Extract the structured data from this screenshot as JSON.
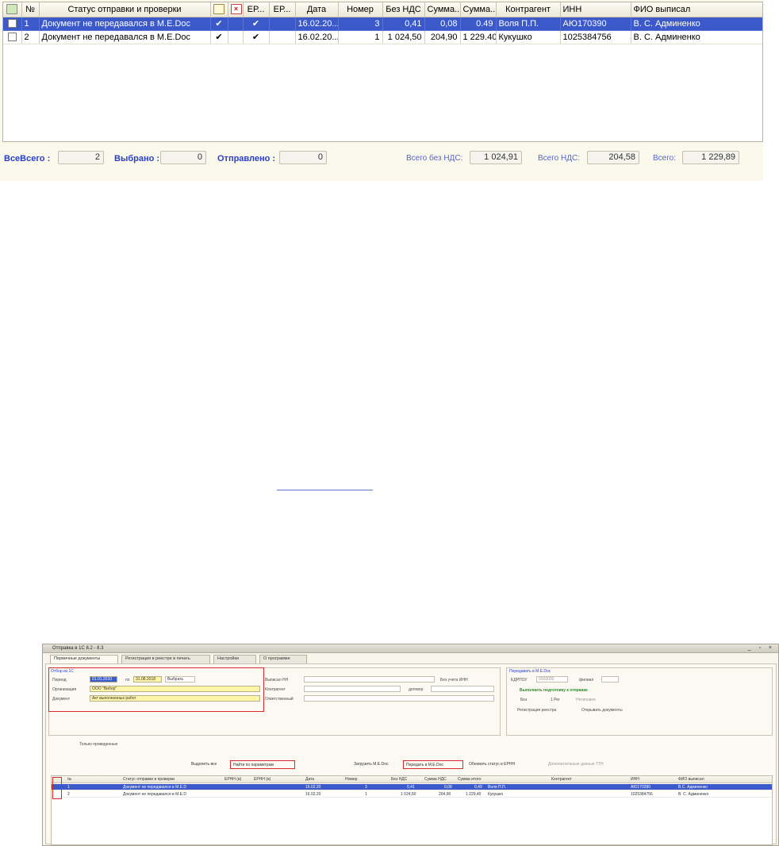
{
  "grid": {
    "columns": [
      "",
      "№",
      "Статус отправки и проверки",
      "",
      "",
      "ЕР...",
      "ЕР...",
      "Дата",
      "Номер",
      "Без НДС",
      "Сумма...",
      "Сумма...",
      "Контрагент",
      "ИНН",
      "ФИО выписал"
    ],
    "header_icons": [
      "select-all-icon",
      "document-icon",
      "delete-icon"
    ],
    "rows": [
      {
        "num": "1",
        "status": "Документ не передавался в M.E.Doc",
        "c1": "✔",
        "c2": "",
        "er1": "✔",
        "er2": "",
        "date": "16.02.20...",
        "number": "3",
        "no_vat": "0,41",
        "vat": "0,08",
        "total": "0.49",
        "counterparty": "Воля П.П.",
        "inn": "АЮ170390",
        "issued_by": "В. С. Админенко",
        "selected": true
      },
      {
        "num": "2",
        "status": "Документ не передавался в M.E.Doc",
        "c1": "✔",
        "c2": "",
        "er1": "✔",
        "er2": "",
        "date": "16.02.20...",
        "number": "1",
        "no_vat": "1 024,50",
        "vat": "204,90",
        "total": "1 229.40",
        "counterparty": "Кукушко",
        "inn": "1025384756",
        "issued_by": "В. С. Админенко",
        "selected": false
      }
    ]
  },
  "totals": {
    "all_label": "ВсеВсего :",
    "all_value": "2",
    "selected_label": "Выбрано :",
    "selected_value": "0",
    "sent_label": "Отправлено :",
    "sent_value": "0",
    "no_vat_label": "Всего без НДС:",
    "no_vat_value": "1 024,91",
    "vat_label": "Всего НДС:",
    "vat_value": "204,58",
    "total_label": "Всего:",
    "total_value": "1 229,89"
  },
  "window": {
    "title": "Отправка в 1С 8.2 - 8.3",
    "tabs": [
      "Первичные документы",
      "Регистрация в реестре в печать",
      "Настройки",
      "О программе"
    ],
    "filter": {
      "legend": "Отбор из 1С",
      "period_label": "Период",
      "period_from": "01.01.2010",
      "period_to_label": "по",
      "period_to": "31.08.2018",
      "choose_button": "Выбрать",
      "org_label": "Организация",
      "org_value": "ООО \"Вибор\"",
      "doc_label": "Документ",
      "doc_value": "Акт выполненных работ",
      "issued_label": "Выписал НН",
      "counterparty_label": "Контрагент",
      "contract_label": "договор",
      "responsible_label": "Ответственный",
      "no_inn_label": "Без учета ИНН",
      "only_posted": "Только проведенные"
    },
    "transfer": {
      "legend": "Передавать в M.E.Doc",
      "edrpou_label": "ЕДРПОУ",
      "edrpou_value": "0000000",
      "branch_label": "филиал",
      "ready_text": "Выполнить подготовку к отправке",
      "opt1": "Без",
      "opt2": "1 Рег",
      "opt3": "Нетиповое",
      "check1": "Регистрация реестра",
      "check2": "Открывать документы"
    },
    "toolbar": {
      "select_all": "Выделить все",
      "find": "Найти по параметрам",
      "upload": "Загрузить М.Е.Doc",
      "send": "Передать в M.E.Doc",
      "update": "Обновить статус в ЕРНН",
      "extra": "Дополнительные данные ТТН"
    },
    "grid_columns": [
      "№",
      "Статус отправки и проверки",
      "ЕРНН (в)",
      "ЕРНН (в)",
      "Дата",
      "Номер",
      "Без НДС",
      "Сумма НДС",
      "Сумма итого",
      "Контрагент",
      "ИНН",
      "ФИО выписал"
    ],
    "grid_rows": [
      {
        "num": "1",
        "status": "Документ не передавался в M.E.D",
        "date": "16.02.20",
        "number": "3",
        "no_vat": "0,41",
        "vat": "0,08",
        "total": "0,49",
        "counterparty": "Воля П.П.",
        "inn": "АЮ170390",
        "issued_by": "В.С. Админенко"
      },
      {
        "num": "2",
        "status": "Документ не передавался в M.E.D",
        "date": "16.02.20",
        "number": "1",
        "no_vat": "1 024,50",
        "vat": "204,90",
        "total": "1 229,40",
        "counterparty": "Кукушко",
        "inn": "1025384756",
        "issued_by": "В. С. Админенко"
      }
    ]
  },
  "colors": {
    "selection": "#3b59c9",
    "highlight_box": "#d42a2a",
    "label_blue": "#2a3fc8",
    "panel_bg": "#fbf8ec"
  }
}
